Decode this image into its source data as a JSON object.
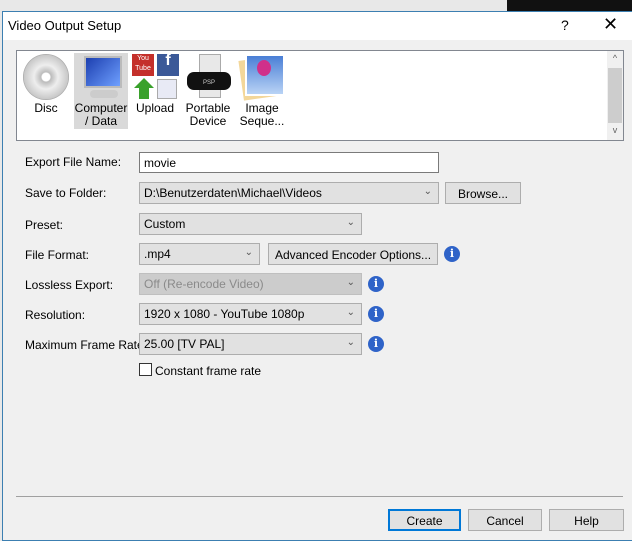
{
  "window": {
    "title": "Video Output Setup",
    "help": "?",
    "close": "✕"
  },
  "targets": [
    {
      "label": "Disc",
      "selected": false
    },
    {
      "label": "Computer / Data",
      "selected": true
    },
    {
      "label": "Upload",
      "selected": false
    },
    {
      "label": "Portable Device",
      "selected": false
    },
    {
      "label": "Image Seque...",
      "selected": false
    }
  ],
  "form": {
    "export_name_label": "Export File Name:",
    "export_name_value": "movie",
    "folder_label": "Save to Folder:",
    "folder_value": "D:\\Benutzerdaten\\Michael\\Videos",
    "browse": "Browse...",
    "preset_label": "Preset:",
    "preset_value": "Custom",
    "format_label": "File Format:",
    "format_value": ".mp4",
    "advanced": "Advanced Encoder Options...",
    "lossless_label": "Lossless Export:",
    "lossless_value": "Off (Re-encode Video)",
    "resolution_label": "Resolution:",
    "resolution_value": "1920 x 1080 - YouTube 1080p",
    "framerate_label": "Maximum Frame Rate:",
    "framerate_value": "25.00 [TV PAL]",
    "constant_label": "Constant frame rate",
    "constant_checked": false
  },
  "footer": {
    "create": "Create",
    "cancel": "Cancel",
    "help": "Help"
  },
  "icons": {
    "info": "i",
    "chevron": "⌄",
    "up": "^",
    "down": "v",
    "psp": "PSP",
    "you": "You",
    "tube": "Tube",
    "fb": "f"
  }
}
